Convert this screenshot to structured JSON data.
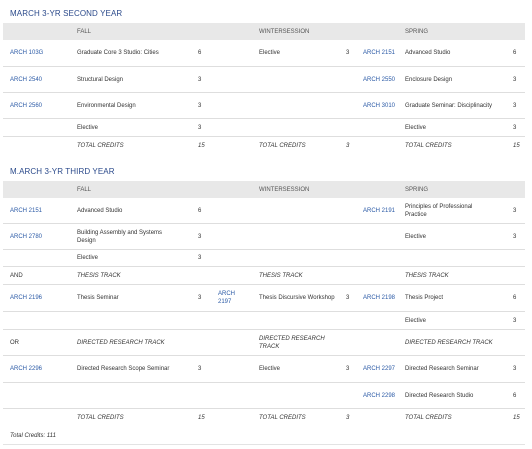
{
  "sections": [
    {
      "title": "MARCH 3-YR SECOND YEAR",
      "headers": {
        "fall": "FALL",
        "winter": "WINTERSESSION",
        "spring": "SPRING"
      },
      "rows": [
        {
          "fall_code": "ARCH 103G",
          "fall_course": "Graduate Core 3 Studio: Cities",
          "fall_cr": "6",
          "winter_code": "",
          "winter_course": "Elective",
          "winter_cr": "3",
          "spring_code": "ARCH 2151",
          "spring_course": "Advanced Studio",
          "spring_cr": "6"
        },
        {
          "fall_code": "ARCH 2540",
          "fall_course": "Structural Design",
          "fall_cr": "3",
          "winter_code": "",
          "winter_course": "",
          "winter_cr": "",
          "spring_code": "ARCH 2550",
          "spring_course": "Enclosure Design",
          "spring_cr": "3"
        },
        {
          "fall_code": "ARCH 2560",
          "fall_course": "Environmental Design",
          "fall_cr": "3",
          "winter_code": "",
          "winter_course": "",
          "winter_cr": "",
          "spring_code": "ARCH 3010",
          "spring_course": "Graduate Seminar: Disciplinacity",
          "spring_cr": "3"
        },
        {
          "fall_code": "",
          "fall_course": "Elective",
          "fall_cr": "3",
          "winter_code": "",
          "winter_course": "",
          "winter_cr": "",
          "spring_code": "",
          "spring_course": "Elective",
          "spring_cr": "3"
        }
      ],
      "total": {
        "fall_label": "TOTAL CREDITS",
        "fall_cr": "15",
        "winter_label": "TOTAL CREDITS",
        "winter_cr": "3",
        "spring_label": "TOTAL CREDITS",
        "spring_cr": "15"
      }
    },
    {
      "title": "M.ARCH 3-YR THIRD YEAR",
      "headers": {
        "fall": "FALL",
        "winter": "WINTERSESSION",
        "spring": "SPRING"
      },
      "rows": [
        {
          "fall_code": "ARCH 2151",
          "fall_course": "Advanced Studio",
          "fall_cr": "6",
          "winter_code": "",
          "winter_course": "",
          "winter_cr": "",
          "spring_code": "ARCH 2191",
          "spring_course": "Principles of Professional Practice",
          "spring_cr": "3"
        },
        {
          "fall_code": "ARCH 2780",
          "fall_course": "Building Assembly and Systems Design",
          "fall_cr": "3",
          "winter_code": "",
          "winter_course": "",
          "winter_cr": "",
          "spring_code": "",
          "spring_course": "Elective",
          "spring_cr": "3"
        },
        {
          "fall_code": "",
          "fall_course": "Elective",
          "fall_cr": "3",
          "winter_code": "",
          "winter_course": "",
          "winter_cr": "",
          "spring_code": "",
          "spring_course": "",
          "spring_cr": ""
        },
        {
          "fall_code": "AND",
          "fall_course": "THESIS TRACK",
          "fall_cr": "",
          "winter_code": "",
          "winter_course": "THESIS TRACK",
          "winter_cr": "",
          "spring_code": "",
          "spring_course": "THESIS TRACK",
          "spring_cr": ""
        },
        {
          "fall_code": "ARCH 2196",
          "fall_course": "Thesis Seminar",
          "fall_cr": "3",
          "winter_code": "ARCH 2197",
          "winter_course": "Thesis Discursive Workshop",
          "winter_cr": "3",
          "spring_code": "ARCH 2198",
          "spring_course": "Thesis Project",
          "spring_cr": "6"
        },
        {
          "fall_code": "",
          "fall_course": "",
          "fall_cr": "",
          "winter_code": "",
          "winter_course": "",
          "winter_cr": "",
          "spring_code": "",
          "spring_course": "Elective",
          "spring_cr": "3"
        },
        {
          "fall_code": "OR",
          "fall_course": "DIRECTED RESEARCH TRACK",
          "fall_cr": "",
          "winter_code": "",
          "winter_course": "DIRECTED RESEARCH TRACK",
          "winter_cr": "",
          "spring_code": "",
          "spring_course": "DIRECTED RESEARCH TRACK",
          "spring_cr": ""
        },
        {
          "fall_code": "ARCH 2296",
          "fall_course": "Directed Research Scope Seminar",
          "fall_cr": "3",
          "winter_code": "",
          "winter_course": "Elective",
          "winter_cr": "3",
          "spring_code": "ARCH 2297",
          "spring_course": "Directed Research Seminar",
          "spring_cr": "3"
        },
        {
          "fall_code": "",
          "fall_course": "",
          "fall_cr": "",
          "winter_code": "",
          "winter_course": "",
          "winter_cr": "",
          "spring_code": "ARCH 2298",
          "spring_course": "Directed Research Studio",
          "spring_cr": "6"
        }
      ],
      "total": {
        "fall_label": "TOTAL CREDITS",
        "fall_cr": "15",
        "winter_label": "TOTAL CREDITS",
        "winter_cr": "3",
        "spring_label": "TOTAL CREDITS",
        "spring_cr": "15"
      }
    }
  ],
  "footer": "Total Credits: 111"
}
